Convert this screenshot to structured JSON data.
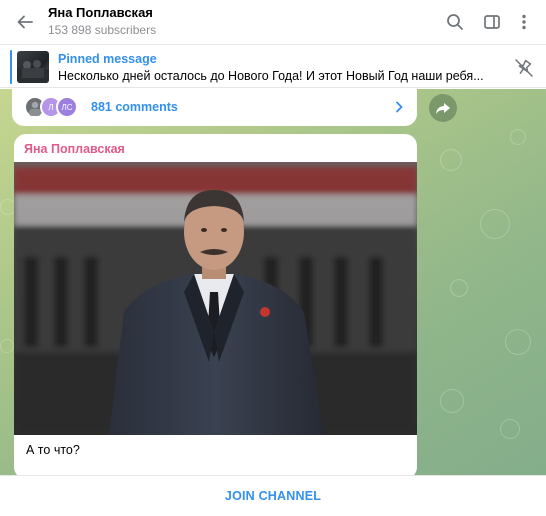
{
  "header": {
    "channel_name": "Яна Поплавская",
    "subscribers": "153 898 subscribers",
    "icons": [
      "back-arrow-icon",
      "search-icon",
      "sidebar-toggle-icon",
      "more-vertical-icon"
    ]
  },
  "pinned": {
    "title": "Pinned message",
    "text": "Несколько дней осталось до Нового Года!   И этот Новый Год наши ребя...",
    "icons": [
      "unpin-icon"
    ]
  },
  "previous_message": {
    "avatars": [
      {
        "initials": "",
        "color": "#6c6f73"
      },
      {
        "initials": "Л",
        "color": "#b596e6"
      },
      {
        "initials": "ЛС",
        "color": "#9d7fe0"
      }
    ],
    "comments": "881 comments"
  },
  "message": {
    "sender": "Яна Поплавская",
    "caption": "А то что?"
  },
  "footer": {
    "join_label": "JOIN CHANNEL"
  },
  "colors": {
    "accent": "#3390ec",
    "sender": "#e05b86",
    "chat_bg_start": "#c5d690",
    "chat_bg_end": "#84ad8a"
  }
}
